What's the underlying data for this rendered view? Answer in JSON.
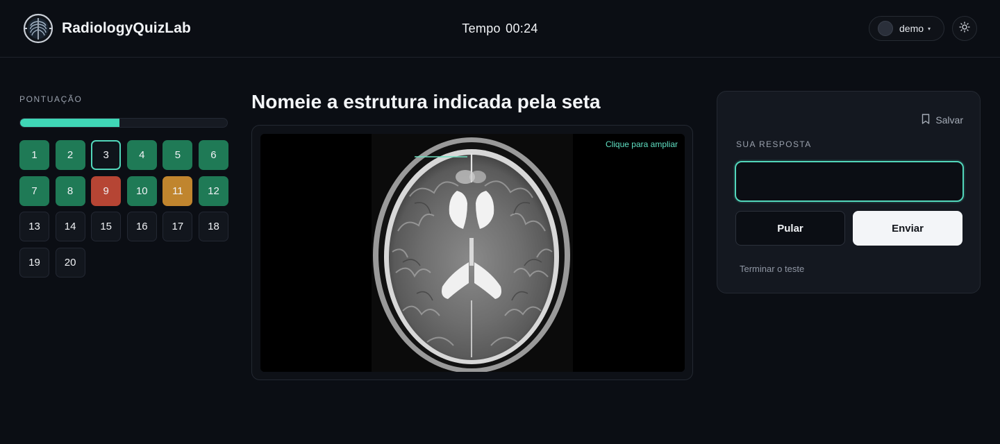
{
  "header": {
    "app_title": "RadiologyQuizLab",
    "timer_label": "Tempo",
    "timer_value": "00:24",
    "user_name": "demo",
    "user_caret": "▾",
    "logo_icon": "ribcage-logo-icon",
    "theme_icon": "sun-icon"
  },
  "sidebar": {
    "score_label": "PONTUAÇÃO",
    "progress": 0.48,
    "questions": [
      {
        "n": "1",
        "status": "correct"
      },
      {
        "n": "2",
        "status": "correct"
      },
      {
        "n": "3",
        "status": "current"
      },
      {
        "n": "4",
        "status": "correct"
      },
      {
        "n": "5",
        "status": "correct"
      },
      {
        "n": "6",
        "status": "correct"
      },
      {
        "n": "7",
        "status": "correct"
      },
      {
        "n": "8",
        "status": "correct"
      },
      {
        "n": "9",
        "status": "wrong"
      },
      {
        "n": "10",
        "status": "correct"
      },
      {
        "n": "11",
        "status": "partial"
      },
      {
        "n": "12",
        "status": "correct"
      },
      {
        "n": "13",
        "status": "pending"
      },
      {
        "n": "14",
        "status": "pending"
      },
      {
        "n": "15",
        "status": "pending"
      },
      {
        "n": "16",
        "status": "pending"
      },
      {
        "n": "17",
        "status": "pending"
      },
      {
        "n": "18",
        "status": "pending"
      },
      {
        "n": "19",
        "status": "pending"
      },
      {
        "n": "20",
        "status": "pending"
      }
    ]
  },
  "main": {
    "question_title": "Nomeie a estrutura indicada pela seta",
    "zoom_hint": "Clique para ampliar"
  },
  "answer_panel": {
    "save_label": "Salvar",
    "save_icon": "bookmark-icon",
    "answer_label": "SUA RESPOSTA",
    "answer_value": "",
    "skip_label": "Pular",
    "submit_label": "Enviar",
    "finish_label": "Terminar o teste"
  },
  "colors": {
    "accent": "#52d7bb",
    "correct": "#1f7a56",
    "wrong": "#b64534",
    "partial": "#c0852e",
    "background": "#0b0e14"
  }
}
